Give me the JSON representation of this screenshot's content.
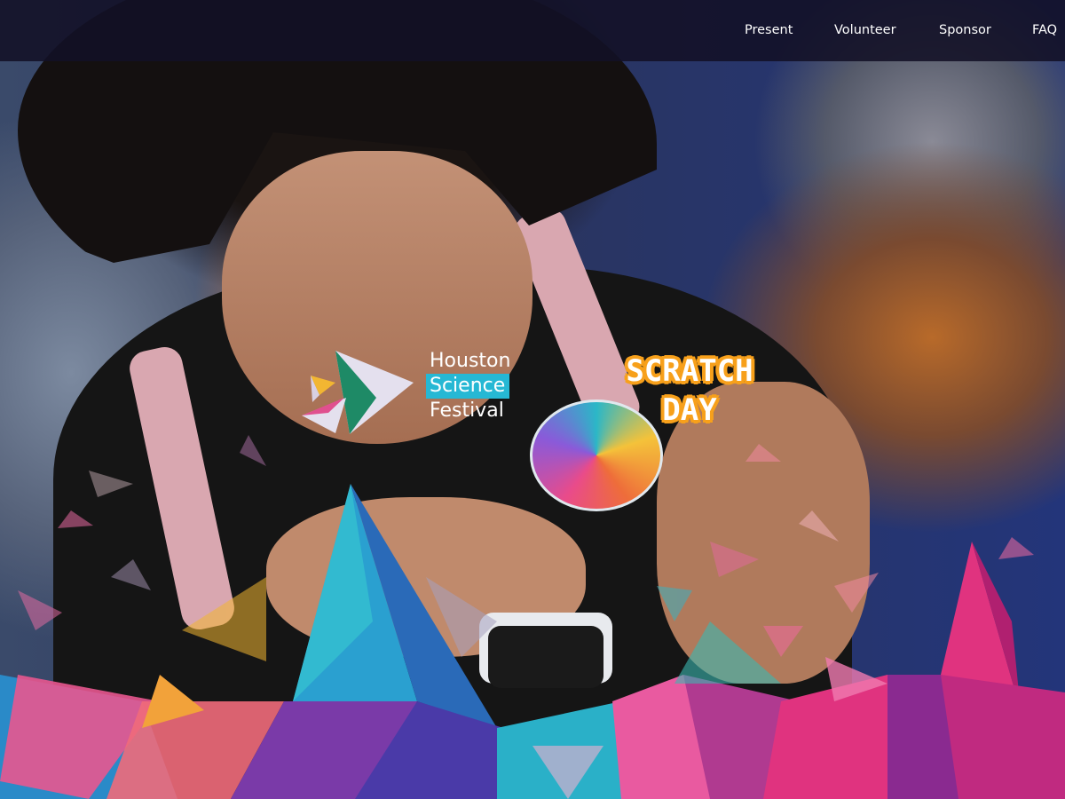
{
  "nav": {
    "items": [
      {
        "label": "Present"
      },
      {
        "label": "Volunteer"
      },
      {
        "label": "Sponsor"
      },
      {
        "label": "FAQ"
      }
    ]
  },
  "logo": {
    "line1": "Houston",
    "line2": "Science",
    "line3": "Festival"
  },
  "event_badge": {
    "line1": "SCRATCH",
    "line2": "DAY"
  },
  "colors": {
    "science_highlight": "#26b8d4",
    "scratch_orange": "#f7a01b",
    "nav_bg": "#121026"
  }
}
